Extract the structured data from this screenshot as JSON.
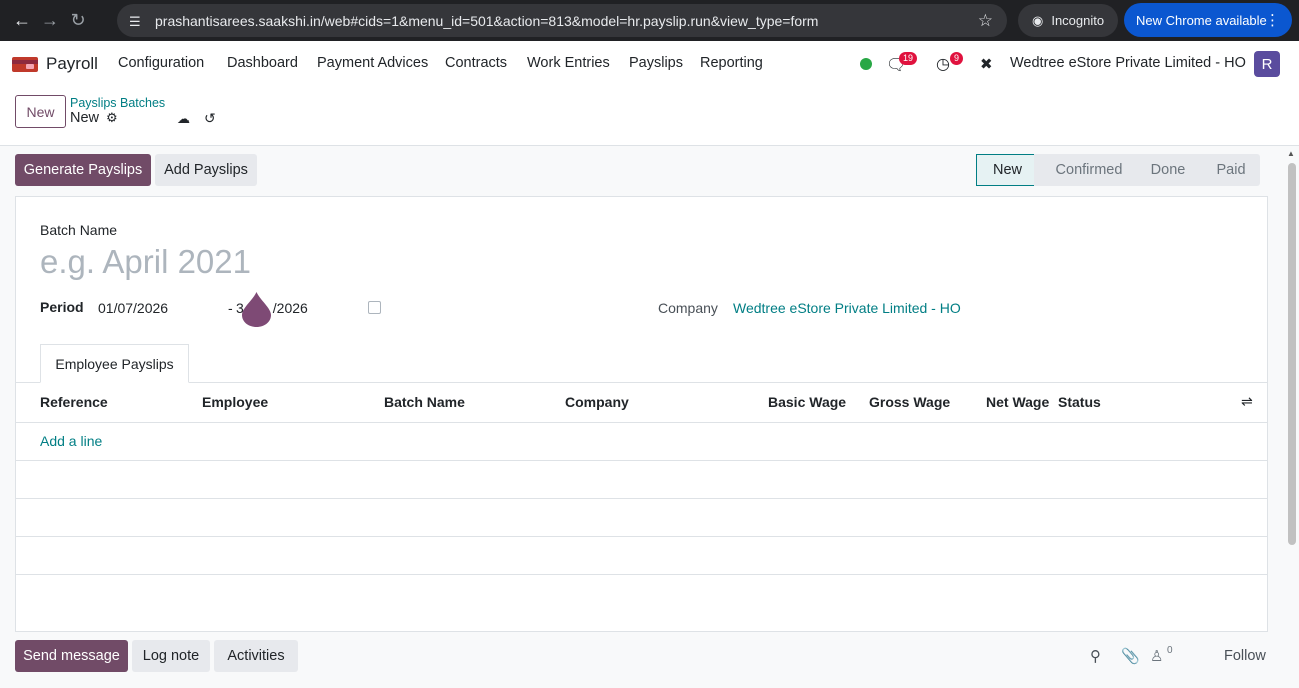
{
  "browser": {
    "url": "prashantisarees.saakshi.in/web#cids=1&menu_id=501&action=813&model=hr.payslip.run&view_type=form",
    "incognito_label": "Incognito",
    "update_label": "New Chrome available"
  },
  "topnav": {
    "app_name": "Payroll",
    "menus": [
      "Configuration",
      "Dashboard",
      "Payment Advices",
      "Contracts",
      "Work Entries",
      "Payslips",
      "Reporting"
    ],
    "chat_count": "19",
    "activity_count": "9",
    "company": "Wedtree eStore Private Limited - HO",
    "avatar_initial": "R"
  },
  "control": {
    "new_label": "New",
    "breadcrumb_parent": "Payslips Batches",
    "breadcrumb_current": "New"
  },
  "actions": {
    "generate_label": "Generate Payslips",
    "add_label": "Add Payslips"
  },
  "stages": [
    "New",
    "Confirmed",
    "Done",
    "Paid"
  ],
  "form": {
    "batch_name_label": "Batch Name",
    "batch_name_placeholder": "e.g. April 2021",
    "period_label": "Period",
    "date_start": "01/07/2026",
    "date_sep": "-",
    "date_end": "31/07/2026",
    "date_end_visible": "3",
    "date_end_visible_tail": "/2026",
    "company_label": "Company",
    "company_value": "Wedtree eStore Private Limited - HO"
  },
  "tab": {
    "label": "Employee Payslips"
  },
  "table": {
    "columns": [
      "Reference",
      "Employee",
      "Batch Name",
      "Company",
      "Basic Wage",
      "Gross Wage",
      "Net Wage",
      "Status"
    ],
    "add_line_label": "Add a line"
  },
  "chatter": {
    "send_label": "Send message",
    "log_label": "Log note",
    "activities_label": "Activities",
    "followers_count": "0",
    "follow_label": "Follow"
  },
  "colors": {
    "primary": "#714b67",
    "link": "#017e84",
    "chrome_bg": "#202124",
    "chrome_update": "#0b57d0",
    "badge": "#e0123e",
    "online": "#28a745"
  }
}
